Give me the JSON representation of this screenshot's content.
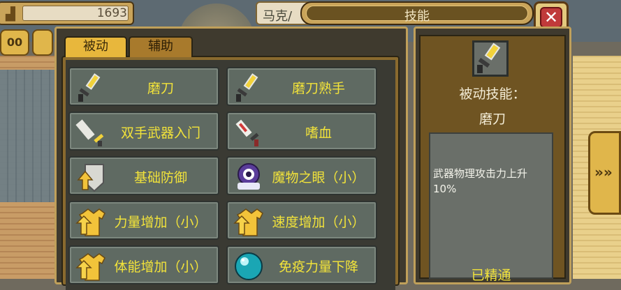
{
  "hud": {
    "gold": "1693",
    "character_name": "马克/",
    "panel_title": "技能"
  },
  "side_buttons": {
    "pause_label": "00"
  },
  "tabs": {
    "passive": "被动",
    "support": "辅助"
  },
  "skills": [
    {
      "name": "磨刀",
      "icon": "sword-sharpen-icon"
    },
    {
      "name": "磨刀熟手",
      "icon": "sword-sharpen-icon"
    },
    {
      "name": "双手武器入门",
      "icon": "greatsword-icon"
    },
    {
      "name": "嗜血",
      "icon": "blood-dagger-icon"
    },
    {
      "name": "基础防御",
      "icon": "shield-up-icon"
    },
    {
      "name": "魔物之眼（小）",
      "icon": "monster-eye-icon"
    },
    {
      "name": "力量增加（小）",
      "icon": "shirt-up-icon"
    },
    {
      "name": "速度增加（小）",
      "icon": "shirt-up-icon"
    },
    {
      "name": "体能增加（小）",
      "icon": "shirt-up-icon"
    },
    {
      "name": "免疫力量下降",
      "icon": "orb-icon"
    }
  ],
  "detail": {
    "type_label": "被动技能：",
    "skill_name": "磨刀",
    "description": "武器物理攻击力上升10%",
    "status": "已精通"
  },
  "colors": {
    "skill_text": "#f2e33a",
    "close_red": "#c03a3a",
    "gold_frame": "#e0b64b"
  }
}
